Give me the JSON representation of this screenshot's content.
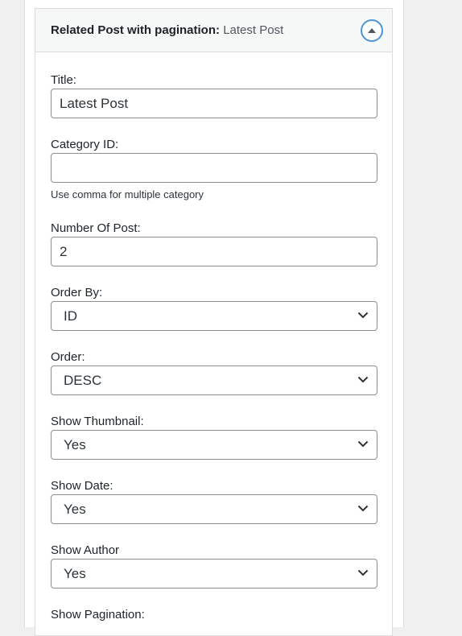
{
  "widget": {
    "title": "Related Post with pagination",
    "separator": ":",
    "instance_title": "Latest Post",
    "toggle_icon": "caret-up-icon"
  },
  "fields": {
    "title": {
      "label": "Title:",
      "value": "Latest Post",
      "placeholder": ""
    },
    "category": {
      "label": "Category ID:",
      "value": "",
      "placeholder": "",
      "help": "Use comma for multiple category"
    },
    "number_of_post": {
      "label": "Number Of Post:",
      "value": "2",
      "placeholder": ""
    },
    "order_by": {
      "label": "Order By:",
      "selected": "ID"
    },
    "order": {
      "label": "Order:",
      "selected": "DESC"
    },
    "show_thumbnail": {
      "label": "Show Thumbnail:",
      "selected": "Yes"
    },
    "show_date": {
      "label": "Show Date:",
      "selected": "Yes"
    },
    "show_author": {
      "label": "Show Author",
      "selected": "Yes"
    },
    "show_pagination": {
      "label": "Show Pagination:"
    }
  },
  "colors": {
    "accent": "#4f94d4",
    "border": "#8c8f94",
    "header_bg": "#f6f7f7",
    "page_bg": "#f0f0f1"
  }
}
